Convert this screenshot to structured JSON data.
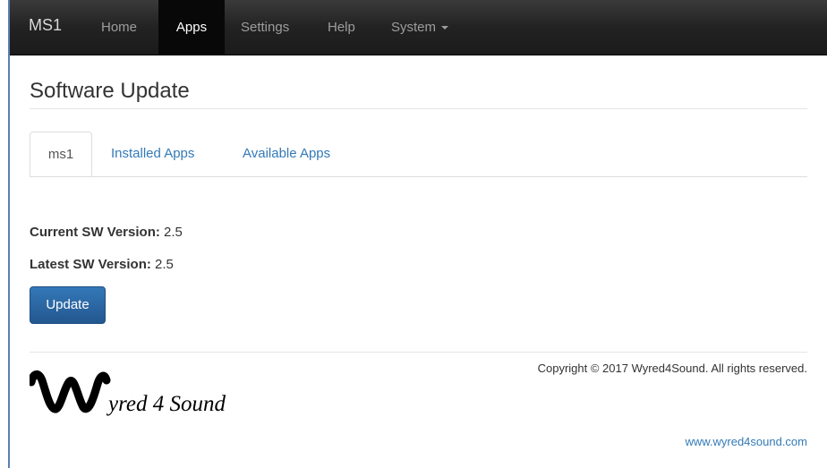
{
  "navbar": {
    "brand": "MS1",
    "items": [
      {
        "label": "Home",
        "active": false
      },
      {
        "label": "Apps",
        "active": true
      },
      {
        "label": "Settings",
        "active": false
      },
      {
        "label": "Help",
        "active": false
      },
      {
        "label": "System",
        "active": false,
        "dropdown": true
      }
    ]
  },
  "page": {
    "title": "Software Update"
  },
  "tabs": [
    {
      "label": "ms1",
      "active": true
    },
    {
      "label": "Installed Apps",
      "active": false
    },
    {
      "label": "Available Apps",
      "active": false
    }
  ],
  "versions": {
    "current_label": "Current SW Version:",
    "current_value": "2.5",
    "latest_label": "Latest SW Version:",
    "latest_value": "2.5"
  },
  "actions": {
    "update_label": "Update"
  },
  "footer": {
    "logo_text": "yred 4 Sound",
    "copyright": "Copyright © 2017 Wyred4Sound. All rights reserved.",
    "link": "www.wyred4sound.com"
  },
  "colors": {
    "navbar_bg": "#222222",
    "link": "#337ab7",
    "button": "#2e6da4"
  },
  "icons": {
    "dropdown_caret": "chevron-down-icon",
    "logo": "wyred4sound-logo"
  }
}
